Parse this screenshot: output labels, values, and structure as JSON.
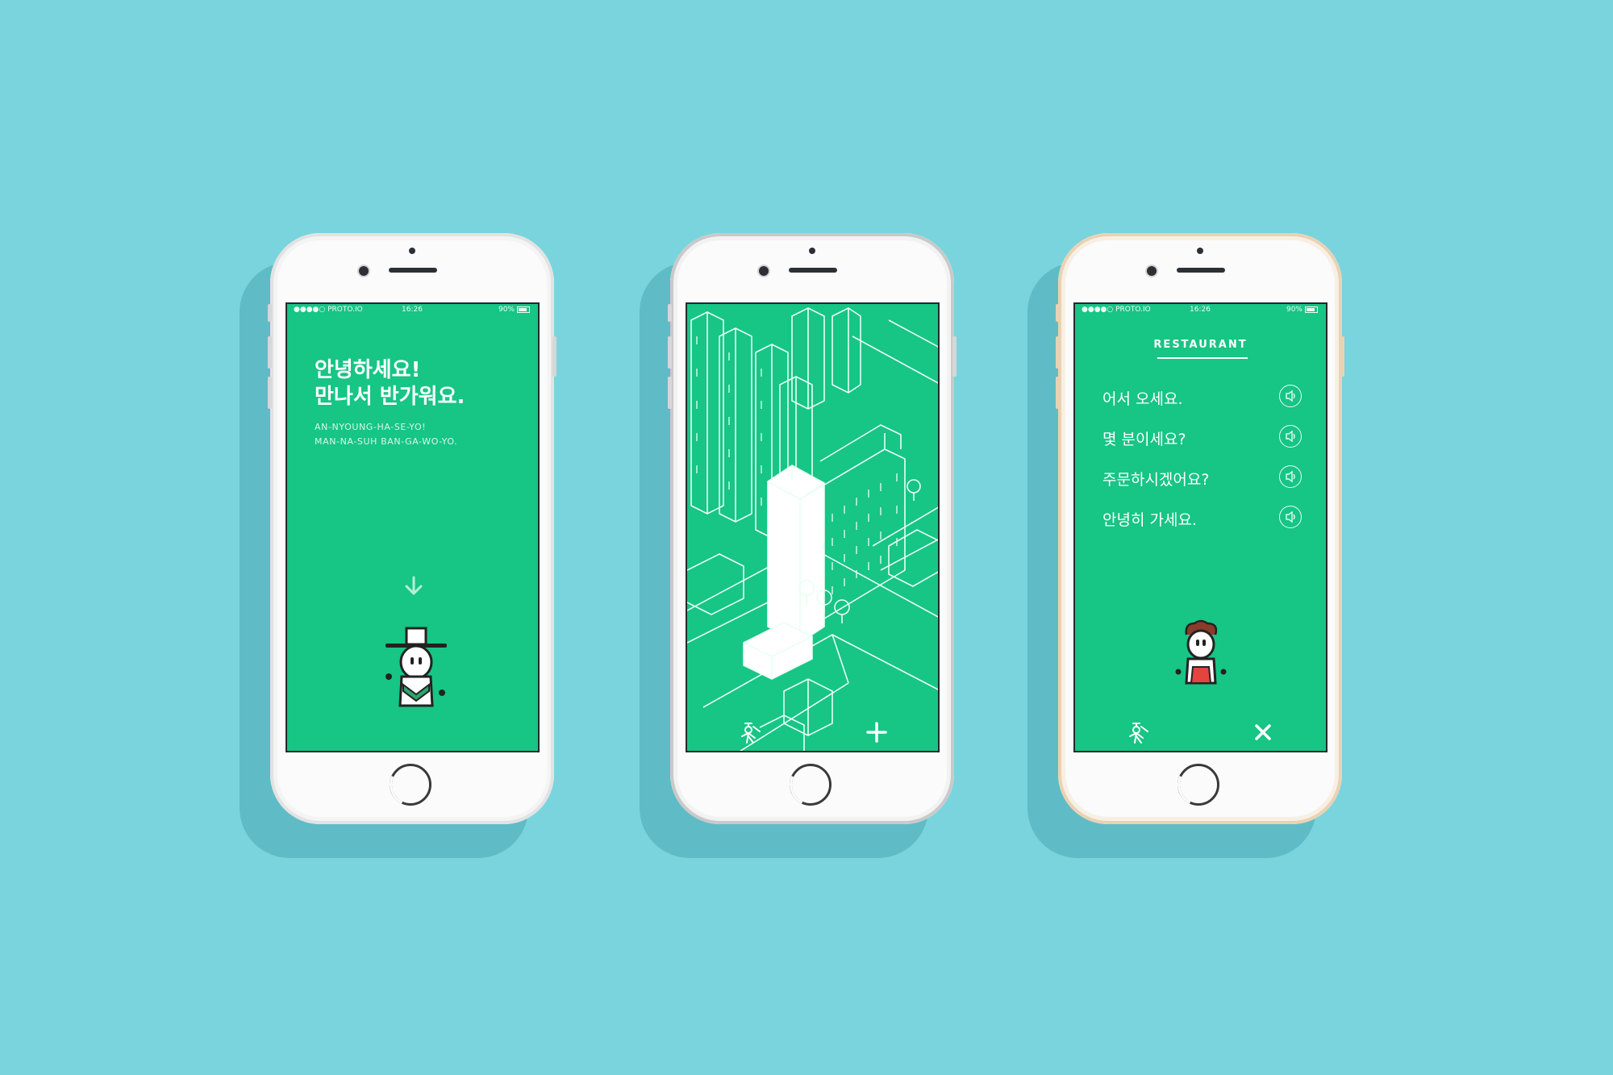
{
  "status": {
    "carrier": "●●●●○ PROTO.IO",
    "time": "16:26",
    "battery": "90%"
  },
  "screen1": {
    "greeting_line1": "안녕하세요!",
    "greeting_line2": "만나서 반가워요.",
    "roman_line1": "AN-NYOUNG-HA-SE-YO!",
    "roman_line2": "MAN-NA-SUH BAN-GA-WO-YO."
  },
  "screen2": {
    "icons": [
      "character-icon",
      "plus-icon"
    ]
  },
  "screen3": {
    "title": "RESTAURANT",
    "phrases": [
      "어서 오세요.",
      "몇 분이세요?",
      "주문하시겠어요?",
      "안녕히 가세요."
    ],
    "icons": [
      "character-icon",
      "close-icon"
    ]
  },
  "colors": {
    "background": "#79d4de",
    "screen_green": "#17c585",
    "accent_red": "#e2453e"
  }
}
